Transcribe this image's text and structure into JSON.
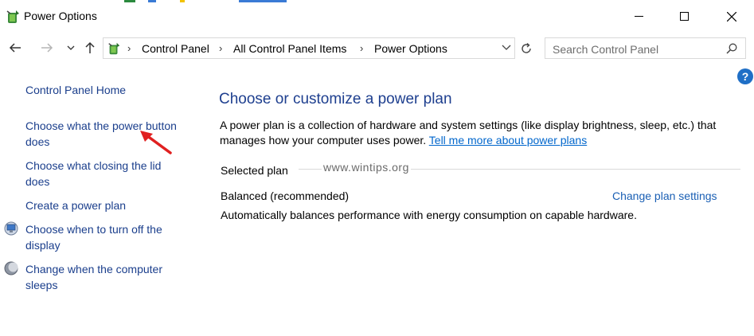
{
  "window": {
    "title": "Power Options"
  },
  "address_bar": {
    "breadcrumbs": [
      "Control Panel",
      "All Control Panel Items",
      "Power Options"
    ]
  },
  "search": {
    "placeholder": "Search Control Panel"
  },
  "help": {
    "label": "?"
  },
  "sidebar": {
    "home_link": "Control Panel Home",
    "items": [
      {
        "label_line1": "Choose what the power button",
        "label_line2": "does"
      },
      {
        "label_line1": "Choose what closing the lid",
        "label_line2": "does"
      },
      {
        "label_line1": "Create a power plan"
      },
      {
        "label_line1": "Choose when to turn off the",
        "label_line2": "display",
        "icon": "monitor-icon"
      },
      {
        "label_line1": "Change when the computer",
        "label_line2": "sleeps",
        "icon": "sleep-moon-icon"
      }
    ]
  },
  "main": {
    "heading": "Choose or customize a power plan",
    "description": "A power plan is a collection of hardware and system settings (like display brightness, sleep, etc.) that manages how your computer uses power.",
    "learn_more_link": "Tell me more about power plans",
    "selected_plan_label": "Selected plan",
    "plan": {
      "name": "Balanced (recommended)",
      "change_link": "Change plan settings",
      "description": "Automatically balances performance with energy consumption on capable hardware."
    }
  },
  "watermark": "www.wintips.org",
  "annotation": {
    "arrow_color": "#e02020"
  }
}
